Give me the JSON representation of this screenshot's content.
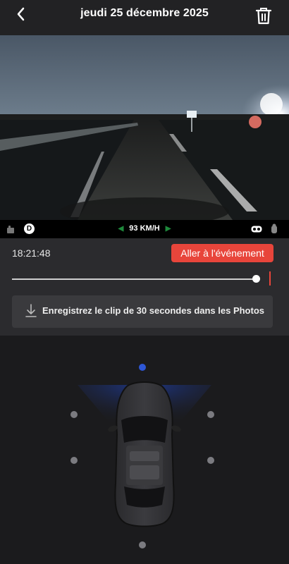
{
  "header": {
    "title": "jeudi 25 décembre 2025"
  },
  "video": {
    "gear": "D",
    "speed": "93 KM/H"
  },
  "playback": {
    "time": "18:21:48",
    "go_to_event_label": "Aller à l'événement",
    "position_fraction": 0.97,
    "save_clip_label": "Enregistrez le clip de 30 secondes dans les Photos"
  },
  "cameras": {
    "active_camera": "front",
    "accent_color": "#2e57d6"
  },
  "colors": {
    "accent_red": "#e8453b",
    "speed_arrow_green": "#1e8a3c"
  }
}
